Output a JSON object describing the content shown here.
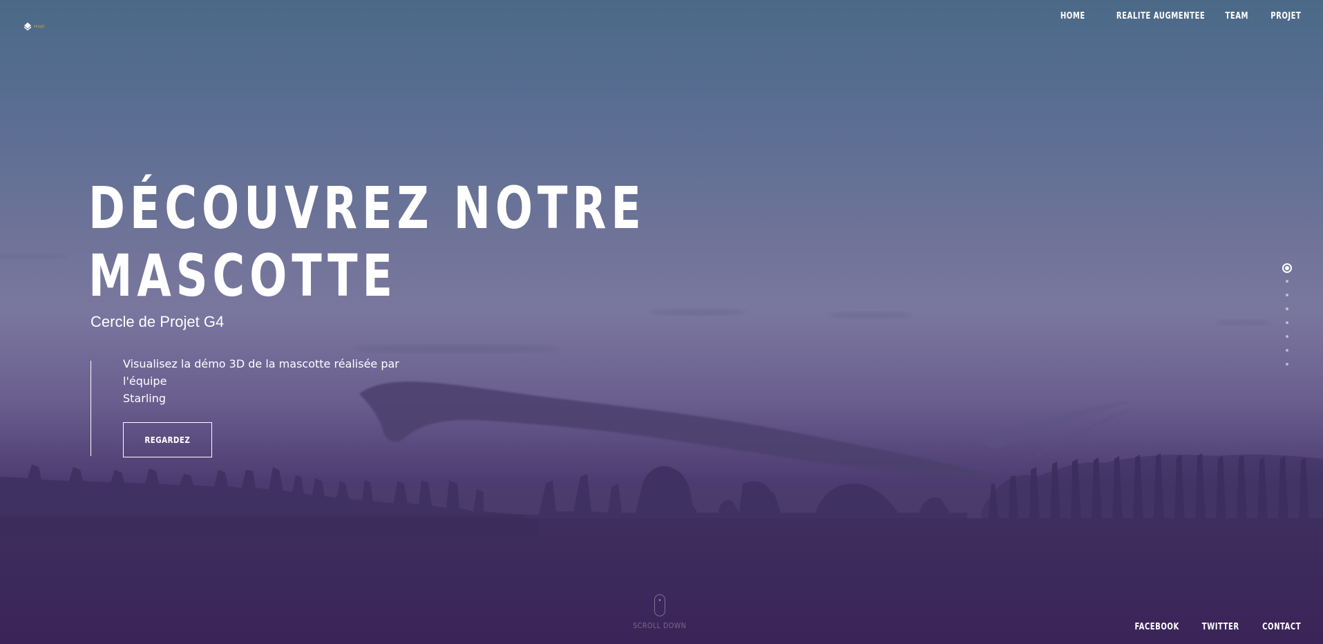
{
  "logo": {
    "icon": "diamond-logo-icon",
    "text": "PROJET"
  },
  "topnav": {
    "items": [
      "HOME",
      "REALITE AUGMENTEE",
      "TEAM",
      "PROJET"
    ]
  },
  "hero": {
    "headline_line1": "DÉCOUVREZ NOTRE",
    "headline_line2": "MASCOTTE",
    "subtitle": "Cercle de Projet G4",
    "description_line1": "Visualisez la démo 3D de la mascotte réalisée par l'équipe",
    "description_line2": "Starling",
    "cta_label": "REGARDEZ"
  },
  "side_nav": {
    "active_index": 0,
    "count": 8
  },
  "scroll": {
    "label": "SCROLL DOWN",
    "icon": "mouse-icon"
  },
  "bottomnav": {
    "items": [
      "FACEBOOK",
      "TWITTER",
      "CONTACT"
    ]
  },
  "colors": {
    "accent_logo": "#e0b33c",
    "text": "#ffffff",
    "overlay_top": "#4b6987",
    "overlay_bottom": "#3c255a"
  }
}
